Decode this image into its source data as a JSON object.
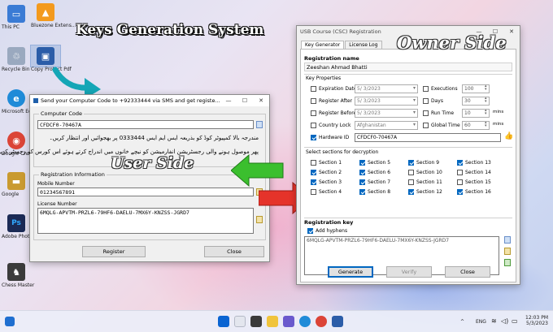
{
  "banner": {
    "title": "Keys Generation System"
  },
  "desktop_icons": [
    {
      "label": "This PC",
      "color": "#3a7bd5",
      "glyph": "▭"
    },
    {
      "label": "Recycle Bin",
      "color": "#9aa9bf",
      "glyph": "♲"
    },
    {
      "label": "Microsoft Edge",
      "color": "#1f8bd8",
      "glyph": "e"
    },
    {
      "label": "Google Chrome",
      "color": "#db4437",
      "glyph": "◉"
    },
    {
      "label": "Google",
      "color": "#c99a30",
      "glyph": "▬"
    },
    {
      "label": "Adobe Photosh...",
      "color": "#1b2a55",
      "glyph": "Ps"
    },
    {
      "label": "Chess Master",
      "color": "#3b3b3b",
      "glyph": "♞"
    },
    {
      "label": "Bluezone Extens...",
      "color": "#f39a1e",
      "glyph": "▲"
    },
    {
      "label": "Copy Protect Pdf",
      "color": "#2b5da8",
      "glyph": "▣"
    }
  ],
  "user_dialog": {
    "title": "Send your Computer Code to +92333444 via SMS and get registe...",
    "window_buttons": [
      "—",
      "☐",
      "✕"
    ],
    "computer_code": {
      "group_title": "Computer Code",
      "value": "CFDCF0-70467A",
      "instruction_line1": "مندرجہ بالا کمپیوٹر کوڈ کو بذریعہ ایس ایم ایس 0333444 پر بھجوائیں اور انتظار کریں۔",
      "instruction_line2": "پھر موصول ہونے والی رجسٹریشن انفارمیشن کو نیچے خانوں میں اندراج کرتے ہوئے اس کورس کو رجسٹر کریں۔"
    },
    "registration_info": {
      "group_title": "Registration Information",
      "mobile_label": "Mobile Number",
      "mobile_value": "01234567891",
      "license_label": "License Number",
      "license_value": "6MQLG-APVTM-PRZL6-79HF6-DAELU-7MX6Y-KNZSS-JGRD7"
    },
    "register_button": "Register",
    "close_button": "Close",
    "side_label": "User Side"
  },
  "owner_window": {
    "title": "USB Course (CSC) Registration",
    "window_buttons": [
      "—",
      "☐",
      "✕"
    ],
    "side_label": "Owner Side",
    "tabs": [
      {
        "label": "Key Generator",
        "active": true
      },
      {
        "label": "License Log",
        "active": false
      }
    ],
    "registration_name": {
      "heading": "Registration name",
      "value": "Zeeshan Ahmad Bhatti"
    },
    "key_properties": {
      "heading": "Key Properties",
      "expiration_date": {
        "label": "Expiration Date",
        "checked": false,
        "value": "5/ 3/2023"
      },
      "register_after": {
        "label": "Register After",
        "checked": false,
        "value": "5/ 3/2023"
      },
      "register_before": {
        "label": "Register Before",
        "checked": false,
        "value": "5/ 3/2023"
      },
      "country_lock": {
        "label": "Country Lock",
        "checked": false,
        "value": "Afghanistan"
      },
      "hardware_id": {
        "label": "Hardware ID",
        "checked": true,
        "value": "CFDCF0-70467A"
      },
      "executions": {
        "label": "Executions",
        "checked": false,
        "value": "100"
      },
      "days": {
        "label": "Days",
        "checked": false,
        "value": "30"
      },
      "run_time": {
        "label": "Run Time",
        "checked": false,
        "value": "10",
        "unit": "mins"
      },
      "global_time": {
        "label": "Global Time",
        "checked": false,
        "value": "60",
        "unit": "mins"
      }
    },
    "sections": {
      "heading": "Select sections for decryption",
      "items": [
        {
          "label": "Section 1",
          "checked": false
        },
        {
          "label": "Section 2",
          "checked": true
        },
        {
          "label": "Section 3",
          "checked": true
        },
        {
          "label": "Section 4",
          "checked": false
        },
        {
          "label": "Section 5",
          "checked": true
        },
        {
          "label": "Section 6",
          "checked": true
        },
        {
          "label": "Section 7",
          "checked": true
        },
        {
          "label": "Section 8",
          "checked": true
        },
        {
          "label": "Section 9",
          "checked": true
        },
        {
          "label": "Section 10",
          "checked": false
        },
        {
          "label": "Section 11",
          "checked": false
        },
        {
          "label": "Section 12",
          "checked": true
        },
        {
          "label": "Section 13",
          "checked": true
        },
        {
          "label": "Section 14",
          "checked": false
        },
        {
          "label": "Section 15",
          "checked": false
        },
        {
          "label": "Section 16",
          "checked": true
        }
      ]
    },
    "registration_key": {
      "heading": "Registration key",
      "add_hyphens_label": "Add hyphens",
      "add_hyphens_checked": true,
      "value": "6MQLG-APVTM-PRZL6-79HF6-DAELU-7MX6Y-KNZSS-JGRD7"
    },
    "buttons": {
      "generate": "Generate",
      "verify": "Verify",
      "close": "Close"
    }
  },
  "taskbar": {
    "lang": "ENG",
    "time": "12:03 PM",
    "date": "5/3/2023"
  },
  "colors": {
    "accent": "#0067c0",
    "green_arrow": "#3bbf2e",
    "red_arrow": "#e5332a",
    "teal_arrow": "#14a6b6"
  }
}
